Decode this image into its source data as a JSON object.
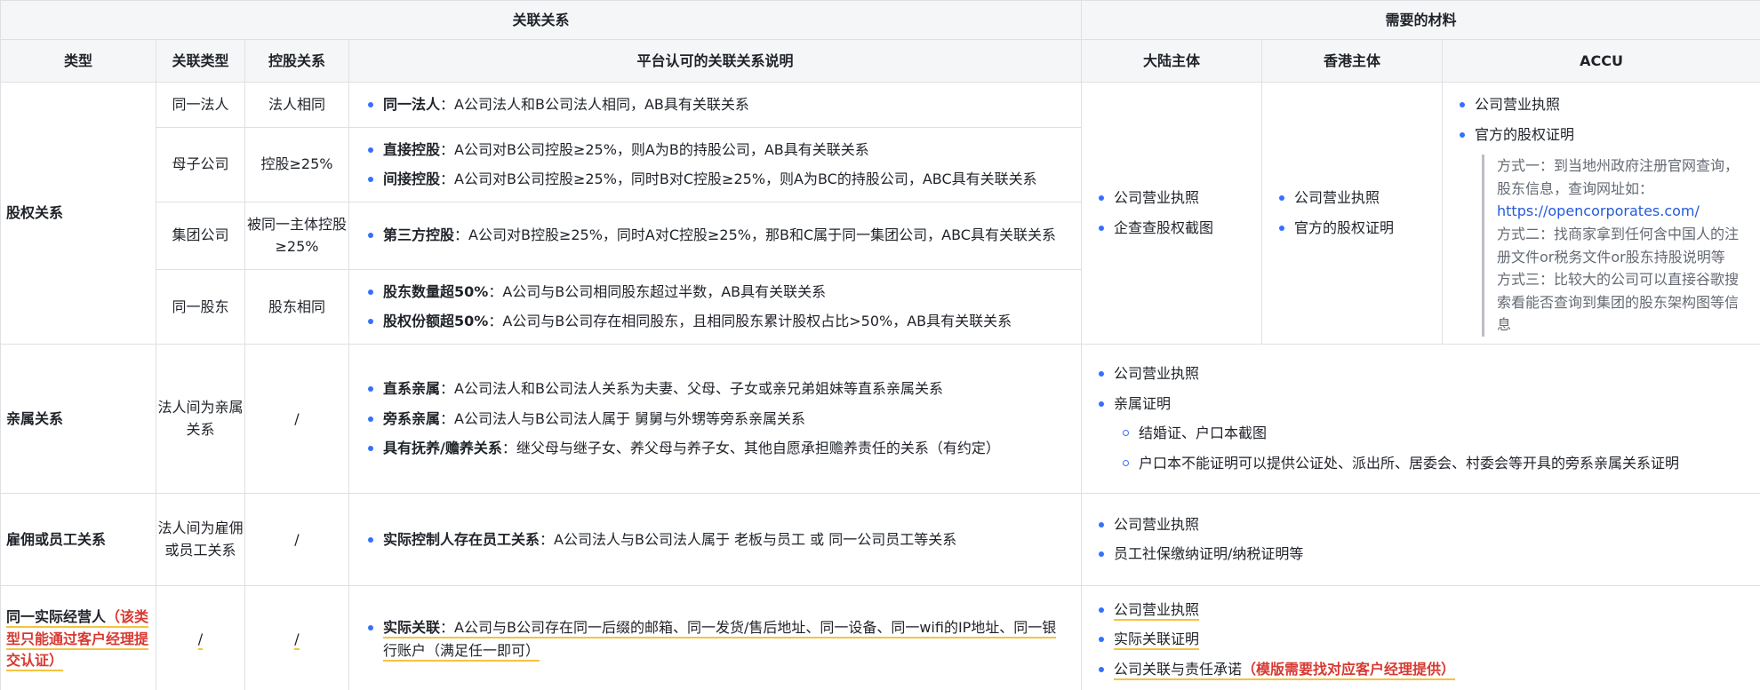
{
  "headers": {
    "group_relation": "关联关系",
    "group_material": "需要的材料",
    "col_type": "类型",
    "col_rel_type": "关联类型",
    "col_holding": "控股关系",
    "col_desc": "平台认可的关联关系说明",
    "col_mainland": "大陆主体",
    "col_hk": "香港主体",
    "col_accu": "ACCU"
  },
  "equity": {
    "type": "股权关系",
    "rows": [
      {
        "rel_type": "同一法人",
        "holding": "法人相同",
        "items": [
          {
            "bold": "同一法人",
            "text": "：A公司法人和B公司法人相同，AB具有关联关系"
          }
        ]
      },
      {
        "rel_type": "母子公司",
        "holding": "控股≥25%",
        "items": [
          {
            "bold": "直接控股",
            "text": "：A公司对B公司控股≥25%，则A为B的持股公司，AB具有关联关系"
          },
          {
            "bold": "间接控股",
            "text": "：A公司对B公司控股≥25%，同时B对C控股≥25%，则A为BC的持股公司，ABC具有关联关系"
          }
        ]
      },
      {
        "rel_type": "集团公司",
        "holding": "被同一主体控股≥25%",
        "items": [
          {
            "bold": "第三方控股",
            "text": "：A公司对B控股≥25%，同时A对C控股≥25%，那B和C属于同一集团公司，ABC具有关联关系"
          }
        ]
      },
      {
        "rel_type": "同一股东",
        "holding": "股东相同",
        "items": [
          {
            "bold": "股东数量超50%",
            "text": "：A公司与B公司相同股东超过半数，AB具有关联关系"
          },
          {
            "bold": "股权份额超50%",
            "text": "：A公司与B公司存在相同股东，且相同股东累计股权占比>50%，AB具有关联关系"
          }
        ]
      }
    ],
    "mainland": [
      "公司营业执照",
      "企查查股权截图"
    ],
    "hk": [
      "公司营业执照",
      "官方的股权证明"
    ],
    "accu": {
      "items": [
        "公司营业执照",
        "官方的股权证明"
      ],
      "way1": "方式一：到当地州政府注册官网查询，股东信息，查询网址如：",
      "way1_link": "https://opencorporates.com/",
      "way2": "方式二：找商家拿到任何含中国人的注册文件or税务文件or股东持股说明等",
      "way3": "方式三：比较大的公司可以直接谷歌搜索看能否查询到集团的股东架构图等信息"
    }
  },
  "kin": {
    "type": "亲属关系",
    "rel_type": "法人间为亲属关系",
    "holding": "/",
    "items": [
      {
        "bold": "直系亲属",
        "text": "：A公司法人和B公司法人关系为夫妻、父母、子女或亲兄弟姐妹等直系亲属关系"
      },
      {
        "bold": "旁系亲属",
        "text": "：A公司法人与B公司法人属于 舅舅与外甥等旁系亲属关系"
      },
      {
        "bold": "具有抚养/赡养关系",
        "text": "：继父母与继子女、养父母与养子女、其他自愿承担赡养责任的关系（有约定）"
      }
    ],
    "materials": [
      "公司营业执照",
      "亲属证明"
    ],
    "sub": [
      "结婚证、户口本截图",
      "户口本不能证明可以提供公证处、派出所、居委会、村委会等开具的旁系亲属关系证明"
    ]
  },
  "employ": {
    "type": "雇佣或员工关系",
    "rel_type": "法人间为雇佣或员工关系",
    "holding": "/",
    "items": [
      {
        "bold": "实际控制人存在员工关系",
        "text": "：A公司法人与B公司法人属于 老板与员工 或 同一公司员工等关系"
      }
    ],
    "materials": [
      "公司营业执照",
      "员工社保缴纳证明/纳税证明等"
    ]
  },
  "operator": {
    "type": "同一实际经营人",
    "type_note": "（该类型只能通过客户经理提交认证）",
    "rel_type": "/",
    "holding": "/",
    "items": [
      {
        "bold": "实际关联",
        "text": "：A公司与B公司存在同一后缀的邮箱、同一发货/售后地址、同一设备、同一wifi的IP地址、同一银行账户（满足任一即可）"
      }
    ],
    "materials": [
      "公司营业执照",
      "实际关联证明",
      "公司关联与责任承诺"
    ],
    "material_note": "（模版需要找对应客户经理提供）"
  }
}
